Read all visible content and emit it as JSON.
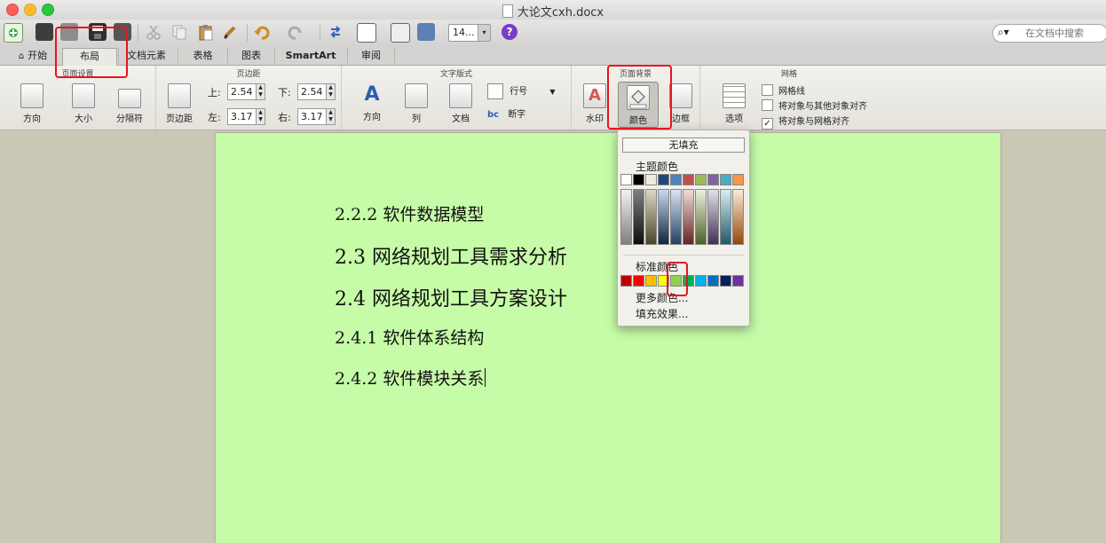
{
  "window": {
    "title": "大论文cxh.docx"
  },
  "toolbar": {
    "zoom_value": "14...",
    "search_placeholder": "在文档中搜索"
  },
  "tabs": [
    {
      "label": "开始"
    },
    {
      "label": "布局"
    },
    {
      "label": "文档元素"
    },
    {
      "label": "表格"
    },
    {
      "label": "图表"
    },
    {
      "label": "SmartArt"
    },
    {
      "label": "审阅"
    }
  ],
  "ribbon": {
    "page_setup": {
      "title": "页面设置",
      "orientation": "方向",
      "size": "大小",
      "breaks": "分隔符"
    },
    "margins": {
      "title": "页边距",
      "button": "页边距",
      "top_label": "上:",
      "top_value": "2.54",
      "bottom_label": "下:",
      "bottom_value": "2.54",
      "left_label": "左:",
      "left_value": "3.17",
      "right_label": "右:",
      "right_value": "3.17"
    },
    "text_layout": {
      "title": "文字版式",
      "direction": "方向",
      "columns": "列",
      "document": "文档",
      "line_numbers": "行号",
      "hyphenation": "断字"
    },
    "page_background": {
      "title": "页面背景",
      "watermark": "水印",
      "color": "颜色",
      "borders": "边框"
    },
    "grid": {
      "title": "网格",
      "options": "选项",
      "gridlines": "网格线",
      "snap_objects": "将对象与其他对象对齐",
      "snap_grid": "将对象与网格对齐"
    }
  },
  "document": {
    "headings": [
      "2.2.2 软件数据模型",
      "2.3 网络规划工具需求分析",
      "2.4 网络规划工具方案设计",
      "2.4.1 软件体系结构",
      "2.4.2 软件模块关系"
    ],
    "page_color": "#c6fca8"
  },
  "color_menu": {
    "no_fill": "无填充",
    "theme_colors": "主题颜色",
    "standard_colors": "标准颜色",
    "more_colors": "更多颜色...",
    "fill_effects": "填充效果...",
    "theme_row": [
      "#ffffff",
      "#000000",
      "#eeece1",
      "#1f497d",
      "#4f81bd",
      "#c0504d",
      "#9bbb59",
      "#8064a2",
      "#4bacc6",
      "#f79646"
    ],
    "standard_row": [
      "#c00000",
      "#ff0000",
      "#ffc000",
      "#ffff00",
      "#92d050",
      "#00b050",
      "#00b0f0",
      "#0070c0",
      "#002060",
      "#7030a0"
    ]
  }
}
